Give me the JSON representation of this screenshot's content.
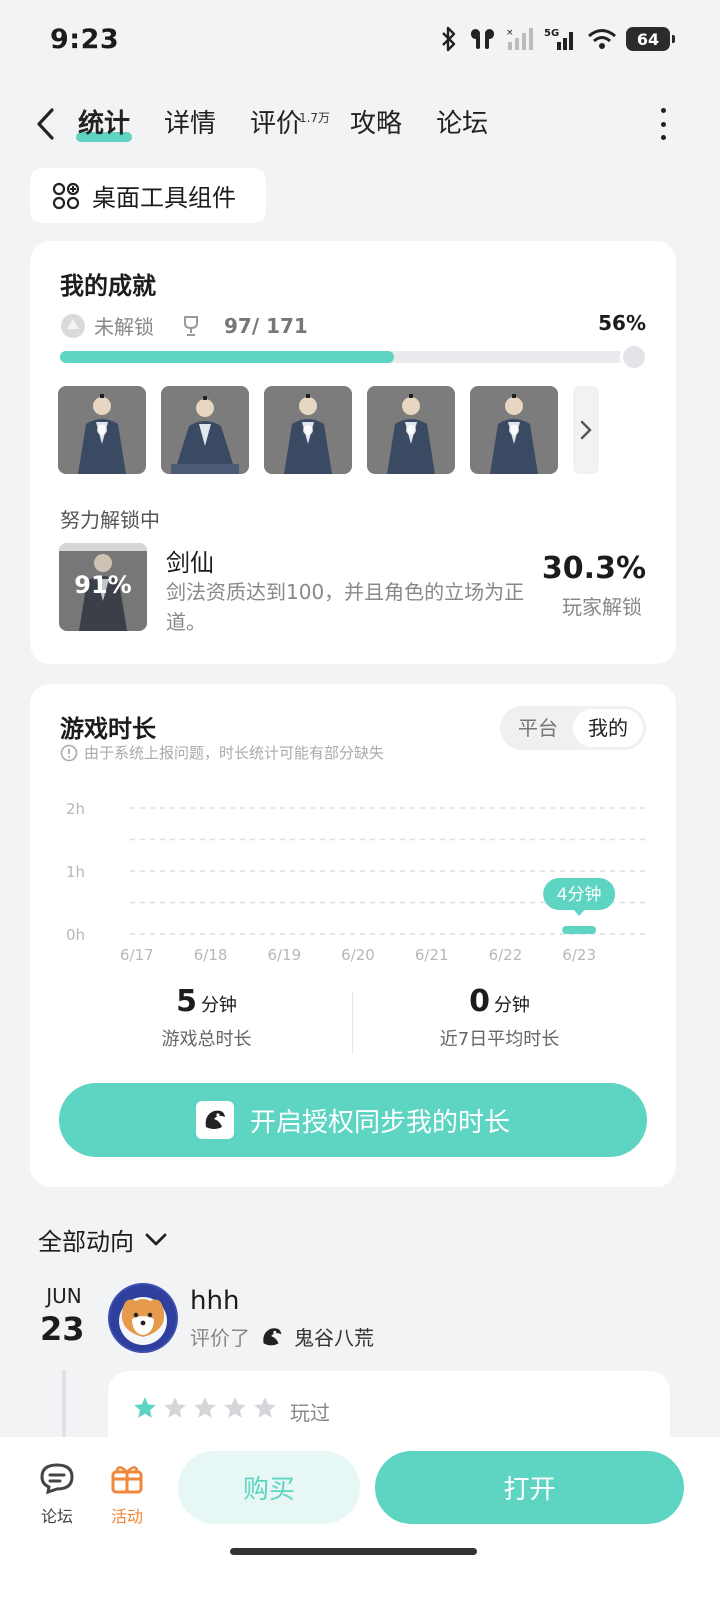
{
  "status_bar": {
    "time": "9:23",
    "battery": "64",
    "network": "5G"
  },
  "nav": {
    "tabs": [
      {
        "label": "统计"
      },
      {
        "label": "详情"
      },
      {
        "label": "评价",
        "badge": "1.7万"
      },
      {
        "label": "攻略"
      },
      {
        "label": "论坛"
      }
    ],
    "active_tab": "统计"
  },
  "widget_chip": {
    "label": "桌面工具组件"
  },
  "achievements": {
    "title": "我的成就",
    "locked_label": "未解锁",
    "count": "97/ 171",
    "percent": "56%",
    "progress": 0.56,
    "unlocking_label": "努力解锁中",
    "current": {
      "thumb_percent": "91%",
      "name": "剑仙",
      "description": "剑法资质达到100，并且角色的立场为正道。",
      "rate": "30.3%",
      "rate_label": "玩家解锁"
    }
  },
  "playtime": {
    "title": "游戏时长",
    "note": "由于系统上报问题，时长统计可能有部分缺失",
    "toggle": {
      "platform": "平台",
      "mine": "我的"
    },
    "total": {
      "value": "5",
      "unit": "分钟",
      "label": "游戏总时长"
    },
    "average": {
      "value": "0",
      "unit": "分钟",
      "label": "近7日平均时长"
    },
    "sync_button": "开启授权同步我的时长"
  },
  "chart_data": {
    "type": "bar",
    "categories": [
      "6/17",
      "6/18",
      "6/19",
      "6/20",
      "6/21",
      "6/22",
      "6/23"
    ],
    "values": [
      0,
      0,
      0,
      0,
      0,
      0,
      4
    ],
    "unit": "分钟",
    "y_ticks": [
      "0h",
      "1h",
      "2h"
    ],
    "ylim_minutes": [
      0,
      120
    ],
    "highlight_label": "4分钟",
    "grid": true,
    "color": "#5ed4c3"
  },
  "feed": {
    "header": "全部动向",
    "month": "JUN",
    "day": "23",
    "user": "hhh",
    "action": "评价了",
    "game": "鬼谷八荒",
    "rating": 1,
    "rating_max": 5,
    "played_label": "玩过"
  },
  "bottom_bar": {
    "forum": "论坛",
    "event": "活动",
    "buy": "购买",
    "open": "打开"
  },
  "colors": {
    "accent": "#5ed4c3",
    "event": "#f0873a",
    "background": "#f2f3f5"
  }
}
